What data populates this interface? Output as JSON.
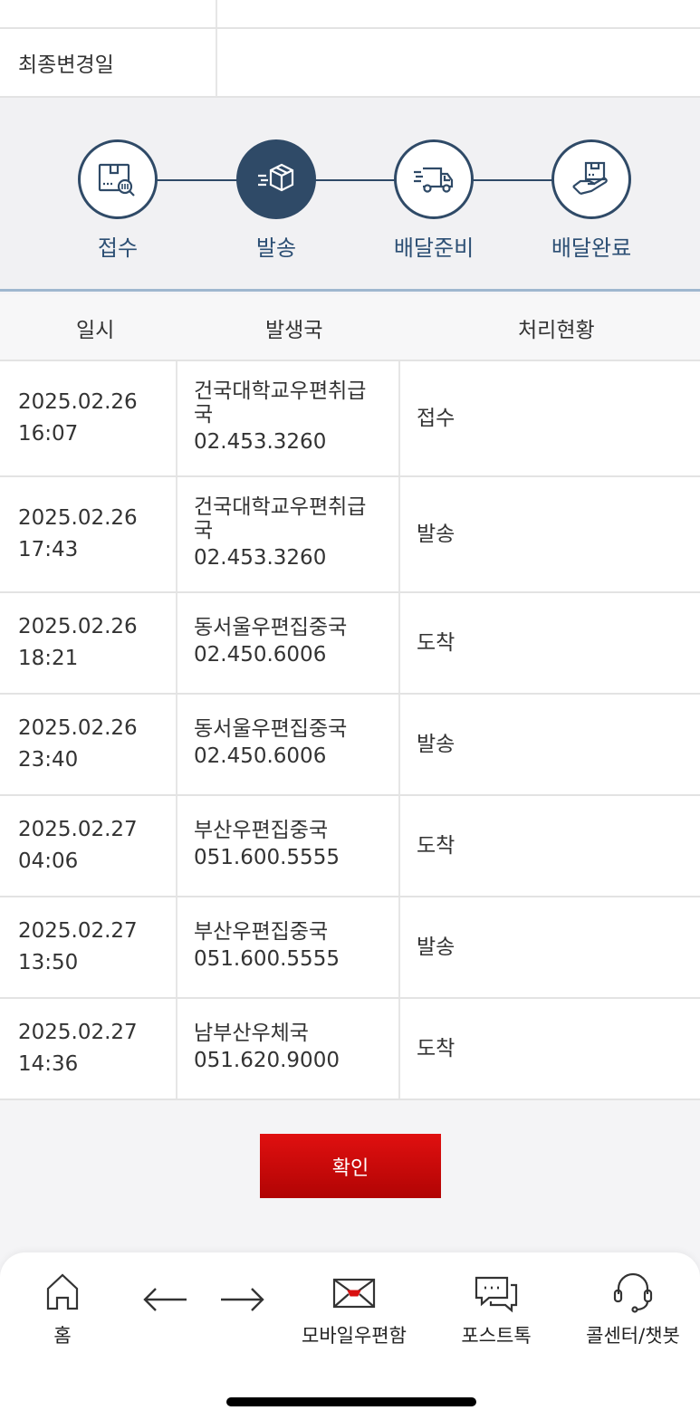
{
  "info": {
    "last_modified_label": "최종변경일",
    "last_modified_value": ""
  },
  "steps": [
    {
      "label": "접수",
      "icon": "box-search-icon",
      "active": false
    },
    {
      "label": "발송",
      "icon": "box-shipping-icon",
      "active": true
    },
    {
      "label": "배달준비",
      "icon": "truck-icon",
      "active": false
    },
    {
      "label": "배달완료",
      "icon": "hand-box-icon",
      "active": false
    }
  ],
  "table": {
    "headers": [
      "일시",
      "발생국",
      "처리현황"
    ],
    "rows": [
      {
        "date": "2025.02.26",
        "time": "16:07",
        "office": "건국대학교우편취급국",
        "phone": "02.453.3260",
        "status": "접수"
      },
      {
        "date": "2025.02.26",
        "time": "17:43",
        "office": "건국대학교우편취급국",
        "phone": "02.453.3260",
        "status": "발송"
      },
      {
        "date": "2025.02.26",
        "time": "18:21",
        "office": "동서울우편집중국",
        "phone": "02.450.6006",
        "status": "도착"
      },
      {
        "date": "2025.02.26",
        "time": "23:40",
        "office": "동서울우편집중국",
        "phone": "02.450.6006",
        "status": "발송"
      },
      {
        "date": "2025.02.27",
        "time": "04:06",
        "office": "부산우편집중국",
        "phone": "051.600.5555",
        "status": "도착"
      },
      {
        "date": "2025.02.27",
        "time": "13:50",
        "office": "부산우편집중국",
        "phone": "051.600.5555",
        "status": "발송"
      },
      {
        "date": "2025.02.27",
        "time": "14:36",
        "office": "남부산우체국",
        "phone": "051.620.9000",
        "status": "도착"
      }
    ]
  },
  "confirm_label": "확인",
  "nav": {
    "home": "홈",
    "back_icon": "arrow-left-icon",
    "forward_icon": "arrow-right-icon",
    "mailbox": "모바일우편함",
    "posttalk": "포스트톡",
    "callcenter": "콜센터/챗봇"
  },
  "colors": {
    "accent": "#2f4a67",
    "step_label": "#2c4f74",
    "confirm": "#d00808"
  }
}
